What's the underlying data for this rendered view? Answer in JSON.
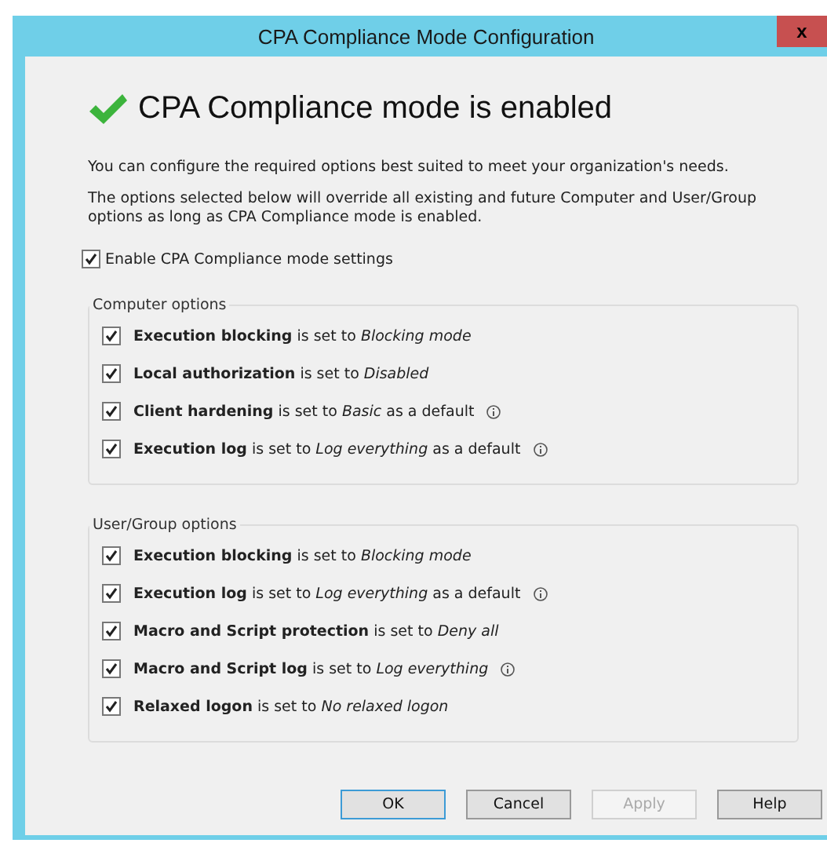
{
  "window": {
    "title": "CPA Compliance Mode Configuration",
    "close": "x"
  },
  "heading": "CPA Compliance mode is enabled",
  "paragraphs": [
    "You can configure the required options best suited to meet your organization's needs.",
    "The options selected below will override all existing and future Computer and User/Group options as long as CPA Compliance mode is enabled."
  ],
  "enable_checkbox": {
    "label": "Enable CPA Compliance mode settings",
    "checked": true
  },
  "groups": [
    {
      "title": "Computer options",
      "options": [
        {
          "text": "**Execution blocking** is set to *Blocking mode*",
          "checked": true,
          "info": false
        },
        {
          "text": "**Local authorization** is set to *Disabled*",
          "checked": true,
          "info": false
        },
        {
          "text": "**Client hardening** is set to *Basic* as a default",
          "checked": true,
          "info": true
        },
        {
          "text": "**Execution log** is set to *Log everything* as a default",
          "checked": true,
          "info": true
        }
      ]
    },
    {
      "title": "User/Group options",
      "options": [
        {
          "text": "**Execution blocking** is set to *Blocking mode*",
          "checked": true,
          "info": false
        },
        {
          "text": "**Execution log** is set to *Log everything* as a default",
          "checked": true,
          "info": true
        },
        {
          "text": "**Macro and Script protection** is set to *Deny all*",
          "checked": true,
          "info": false
        },
        {
          "text": "**Macro and Script log** is set to *Log everything*",
          "checked": true,
          "info": true
        },
        {
          "text": "**Relaxed logon** is set to *No relaxed logon*",
          "checked": true,
          "info": false
        }
      ]
    }
  ],
  "buttons": [
    {
      "label": "OK",
      "default": true,
      "disabled": false
    },
    {
      "label": "Cancel",
      "default": false,
      "disabled": false
    },
    {
      "label": "Apply",
      "default": false,
      "disabled": true
    },
    {
      "label": "Help",
      "default": false,
      "disabled": false
    }
  ]
}
